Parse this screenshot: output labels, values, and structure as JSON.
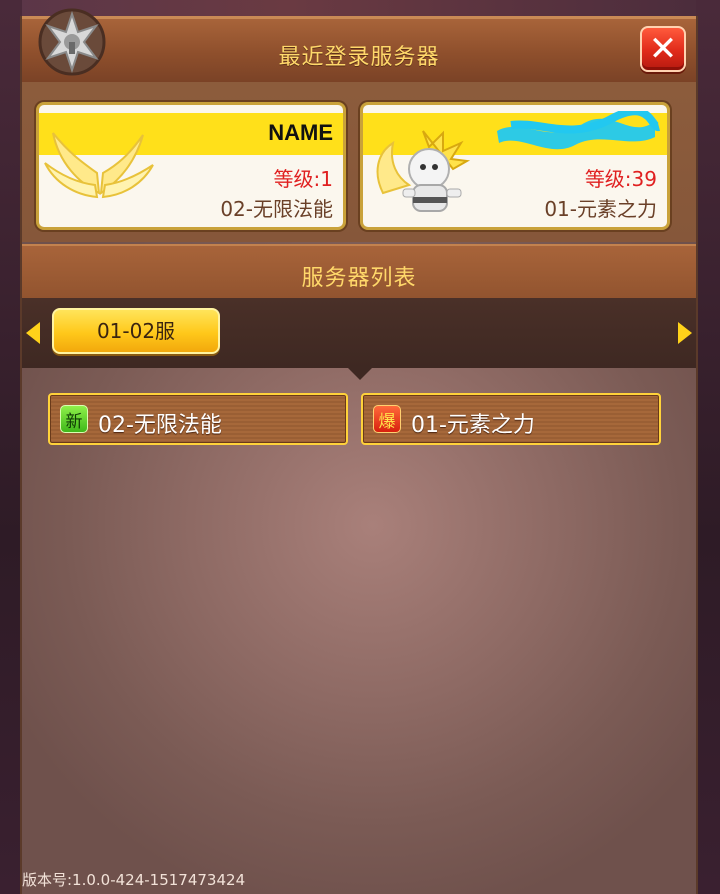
{
  "window": {
    "title": "最近登录服务器",
    "close_label": "✕"
  },
  "recent": [
    {
      "name": "NAME",
      "level": "等级:1",
      "server": "02-无限法能"
    },
    {
      "name": "",
      "level": "等级:39",
      "server": "01-元素之力"
    }
  ],
  "server_list": {
    "title": "服务器列表",
    "tabs": [
      {
        "label": "01-02服",
        "selected": true
      }
    ],
    "servers": [
      {
        "tag": "新",
        "tag_type": "new",
        "name": "02-无限法能"
      },
      {
        "tag": "爆",
        "tag_type": "hot",
        "name": "01-元素之力"
      }
    ]
  },
  "footer": {
    "version": "版本号:1.0.0-424-1517473424"
  },
  "colors": {
    "title_text": "#ffd86a",
    "level_red": "#e02020",
    "tab_yellow": "#ffc81a",
    "server_border": "#ffd23a",
    "redaction_cyan": "#22c8f0"
  }
}
